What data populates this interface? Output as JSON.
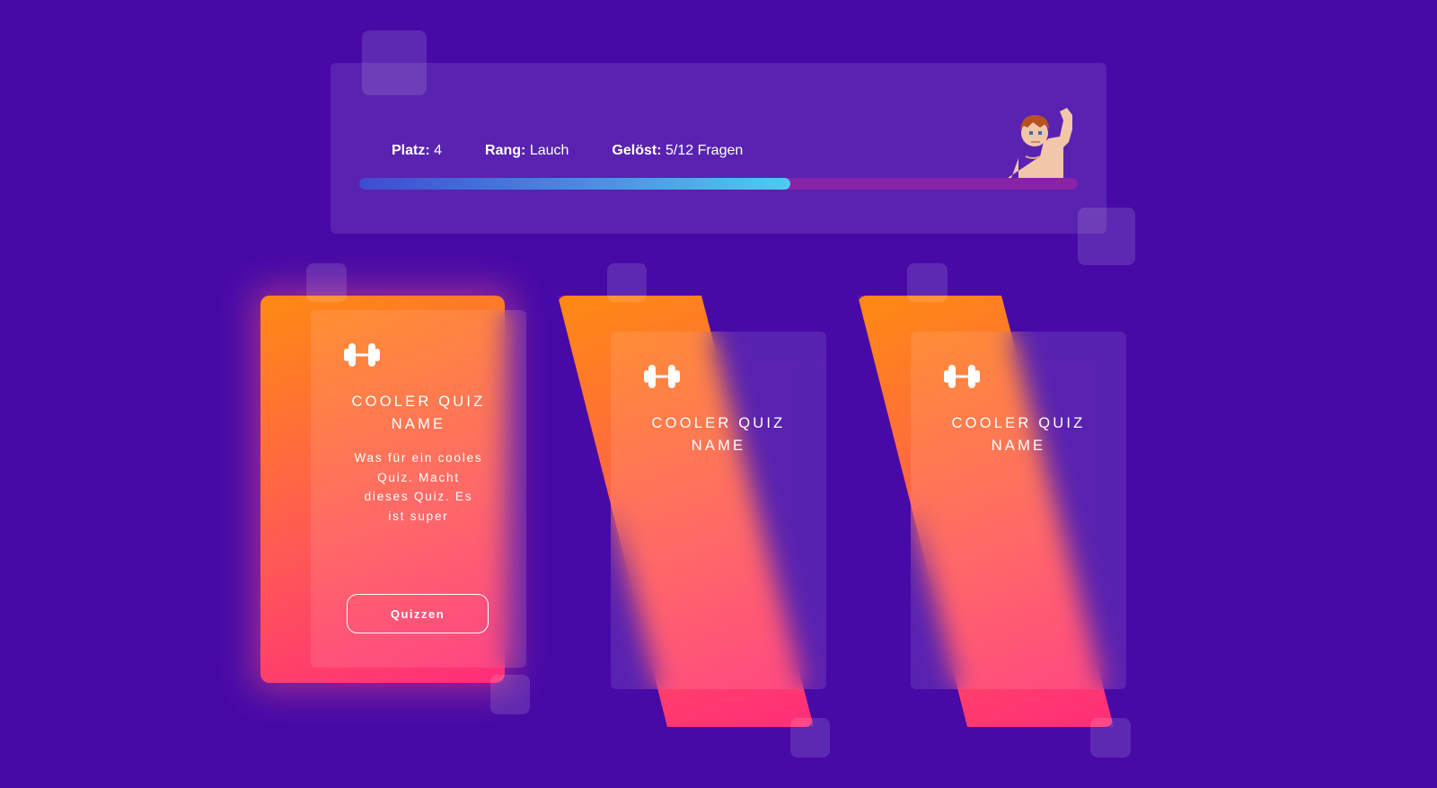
{
  "stats": {
    "platz_label": "Platz:",
    "platz_value": "4",
    "rang_label": "Rang:",
    "rang_value": "Lauch",
    "geloest_label": "Gelöst:",
    "geloest_value": "5/12 Fragen",
    "progress": 0.6,
    "avatar_icon": "flexing-character-icon"
  },
  "cards": [
    {
      "title": "Cooler Quiz Name",
      "description": "Was für ein cooles Quiz. Macht dieses Quiz. Es ist super",
      "button_label": "Quizzen",
      "icon": "dumbbell-icon"
    },
    {
      "title": "Cooler Quiz Name",
      "icon": "dumbbell-icon"
    },
    {
      "title": "Cooler Quiz Name",
      "icon": "dumbbell-icon"
    }
  ],
  "colors": {
    "background": "#470aa7",
    "card_gradient_start": "#ff8a12",
    "card_gradient_end": "#ff2d7a",
    "progress_start": "#3f4bd0",
    "progress_end": "#4fcbf0",
    "progress_track": "#8a22a8"
  }
}
